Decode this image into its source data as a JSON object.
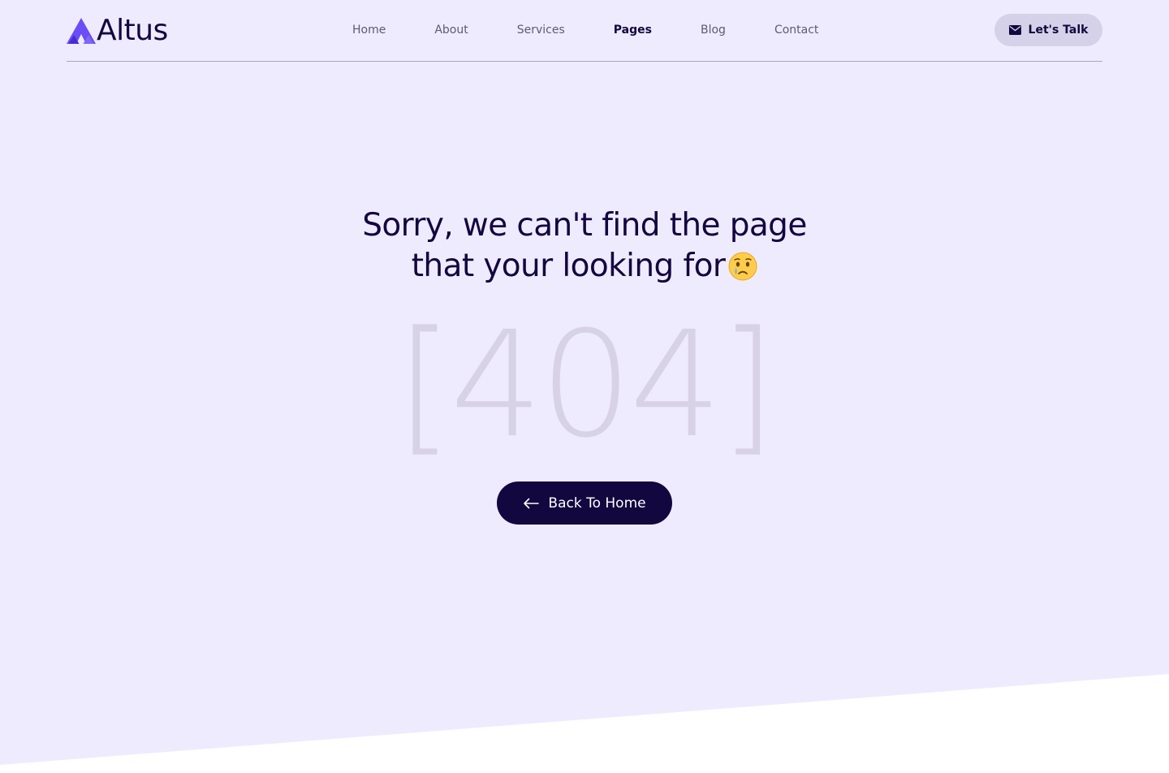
{
  "brand": {
    "name": "Altus",
    "logo_icon": "triangle-mountain-logo",
    "accent_color": "#6a4df4"
  },
  "nav": {
    "items": [
      {
        "label": "Home",
        "active": false
      },
      {
        "label": "About",
        "active": false
      },
      {
        "label": "Services",
        "active": false
      },
      {
        "label": "Pages",
        "active": true
      },
      {
        "label": "Blog",
        "active": false
      },
      {
        "label": "Contact",
        "active": false
      }
    ]
  },
  "cta": {
    "label": "Let's Talk",
    "icon": "envelope-icon"
  },
  "error": {
    "title_line1": "Sorry, we can't find the page",
    "title_line2": "that your looking for",
    "emoji": "crying-face-emoji",
    "code": "[404]"
  },
  "back_button": {
    "label": "Back To Home",
    "icon": "arrow-left-icon"
  },
  "colors": {
    "background": "#efebfe",
    "primary_dark": "#13073f",
    "button_light": "#d5d1e8",
    "code_color": "#d7d2e6",
    "footer_white": "#ffffff"
  }
}
